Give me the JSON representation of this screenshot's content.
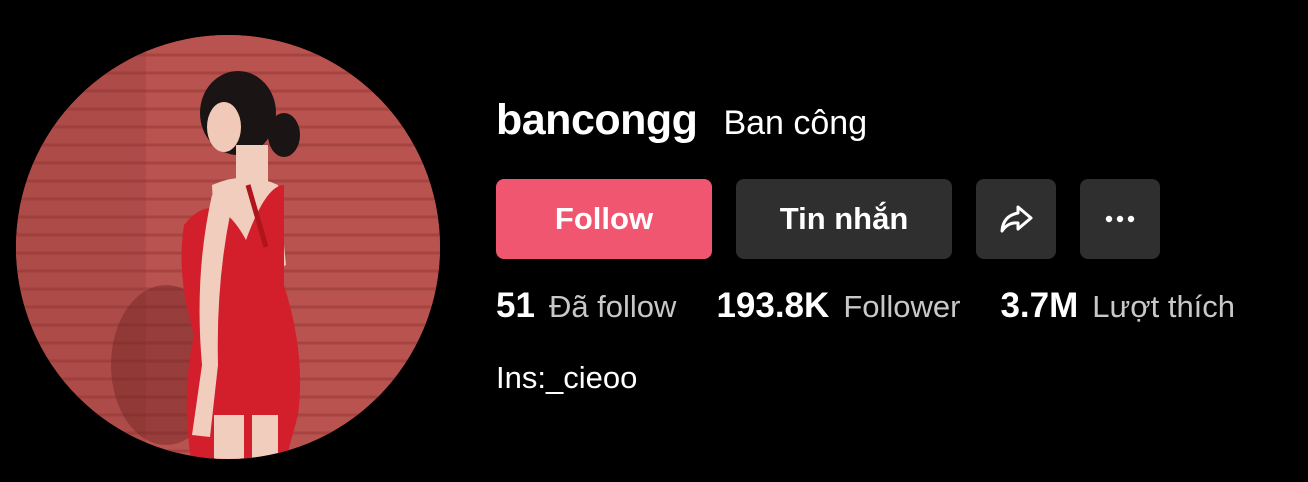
{
  "profile": {
    "username": "bancongg",
    "nickname": "Ban công",
    "bio": "Ins:_cieoo"
  },
  "actions": {
    "follow_label": "Follow",
    "message_label": "Tin nhắn",
    "share_icon": "share-arrow-icon",
    "more_icon": "more-dots-icon"
  },
  "stats": [
    {
      "value": "51",
      "label": "Đã follow"
    },
    {
      "value": "193.8K",
      "label": "Follower"
    },
    {
      "value": "3.7M",
      "label": "Lượt thích"
    }
  ],
  "colors": {
    "follow_button": "#f0566f",
    "secondary_button": "#2f2f2f",
    "background": "#000000"
  }
}
